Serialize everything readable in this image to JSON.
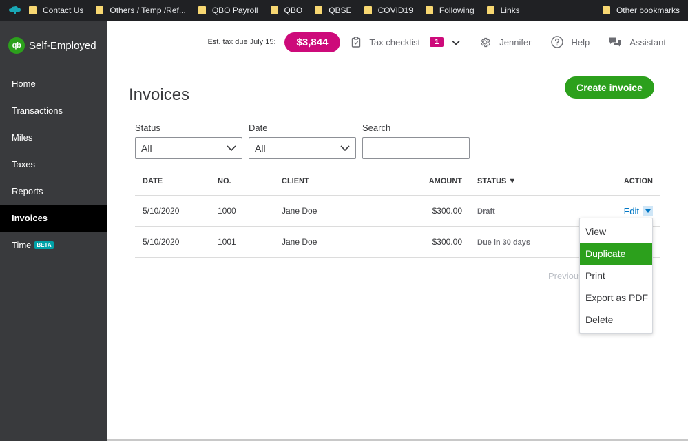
{
  "bookmarks": {
    "items": [
      {
        "label": "Contact Us"
      },
      {
        "label": "Others / Temp /Ref..."
      },
      {
        "label": "QBO Payroll"
      },
      {
        "label": "QBO"
      },
      {
        "label": "QBSE"
      },
      {
        "label": "COVID19"
      },
      {
        "label": "Following"
      },
      {
        "label": "Links"
      }
    ],
    "other": "Other bookmarks"
  },
  "brand": {
    "logo_text": "qb",
    "name": "Self-Employed"
  },
  "sidebar": {
    "items": [
      {
        "label": "Home"
      },
      {
        "label": "Transactions"
      },
      {
        "label": "Miles"
      },
      {
        "label": "Taxes"
      },
      {
        "label": "Reports"
      },
      {
        "label": "Invoices",
        "active": true
      },
      {
        "label": "Time",
        "badge": "BETA"
      }
    ]
  },
  "header": {
    "tax_label": "Est. tax due July 15:",
    "tax_amount": "$3,844",
    "checklist_label": "Tax checklist",
    "checklist_count": "1",
    "user": "Jennifer",
    "help": "Help",
    "assistant": "Assistant"
  },
  "main": {
    "title": "Invoices",
    "create_button": "Create invoice",
    "filters": {
      "status_label": "Status",
      "status_value": "All",
      "date_label": "Date",
      "date_value": "All",
      "search_label": "Search",
      "search_value": ""
    },
    "table": {
      "columns": [
        "DATE",
        "NO.",
        "CLIENT",
        "AMOUNT",
        "STATUS ▼",
        "ACTION"
      ],
      "rows": [
        {
          "date": "5/10/2020",
          "no": "1000",
          "client": "Jane Doe",
          "amount": "$300.00",
          "status": "Draft",
          "action": "Edit"
        },
        {
          "date": "5/10/2020",
          "no": "1001",
          "client": "Jane Doe",
          "amount": "$300.00",
          "status": "Due in 30 days",
          "action": ""
        }
      ]
    },
    "pager": "Previous"
  },
  "dropdown": {
    "items": [
      "View",
      "Duplicate",
      "Print",
      "Export as PDF",
      "Delete"
    ],
    "highlighted": "Duplicate"
  },
  "colors": {
    "accent_green": "#2ca01c",
    "tax_pink": "#cd0a7a",
    "sidebar_bg": "#393a3d",
    "link_blue": "#0077c5"
  }
}
